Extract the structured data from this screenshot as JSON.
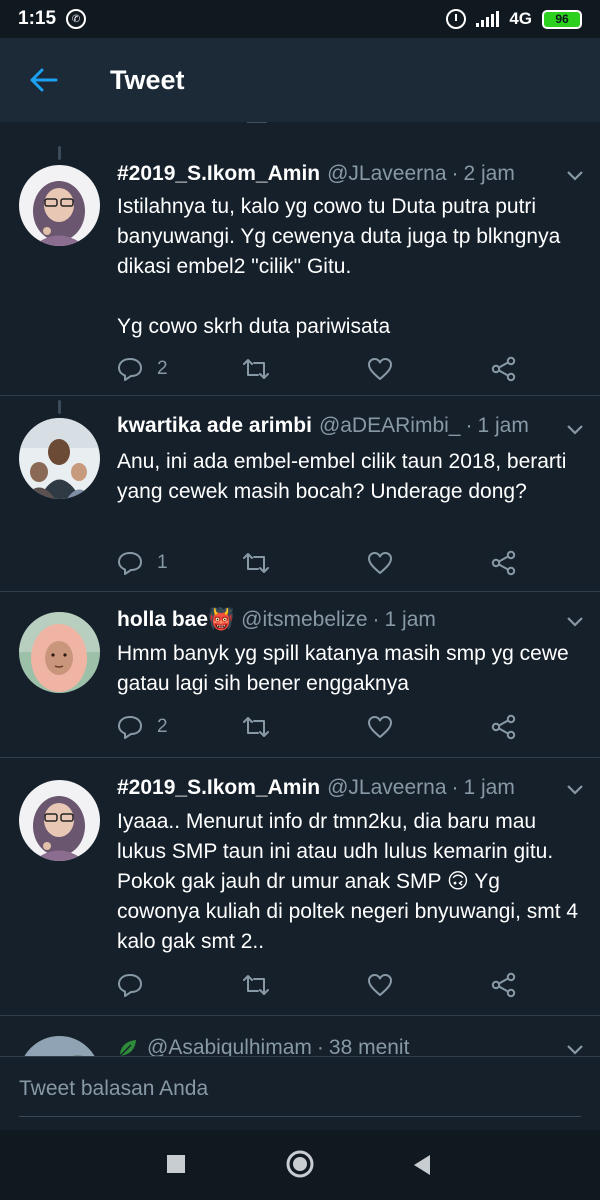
{
  "status_bar": {
    "time": "1:15",
    "network": "4G",
    "battery": "96"
  },
  "header": {
    "title": "Tweet"
  },
  "tweets": [
    {
      "name": "#2019_S.Ikom_Amin",
      "handle": "@JLaveerna",
      "time": "2 jam",
      "lines": [
        "Istilahnya tu, kalo yg cowo tu Duta putra putri banyuwangi. Yg cewenya duta juga tp blkngnya dikasi embel2 \"cilik\" Gitu.",
        "",
        "Yg cowo skrh duta pariwisata"
      ],
      "replies": "2"
    },
    {
      "name": "kwartika ade arimbi",
      "handle": "@aDEARimbi_",
      "time": "1 jam",
      "lines": [
        "Anu, ini ada embel-embel cilik taun 2018, berarti yang cewek masih bocah? Underage dong?"
      ],
      "replies": "1"
    },
    {
      "name": "holla bae👹",
      "handle": "@itsmebelize",
      "time": "1 jam",
      "lines": [
        "Hmm banyk yg spill katanya masih smp yg cewe gatau lagi sih bener enggaknya"
      ],
      "replies": "2"
    },
    {
      "name": "#2019_S.Ikom_Amin",
      "handle": "@JLaveerna",
      "time": "1 jam",
      "lines": [
        "Iyaaa.. Menurut info dr tmn2ku, dia baru mau lukus SMP taun ini atau udh lulus kemarin gitu. Pokok gak jauh dr umur anak SMP 🙃 Yg cowonya kuliah di poltek negeri bnyuwangi, smt 4 kalo gak smt 2.."
      ],
      "replies": ""
    },
    {
      "name": "",
      "handle": "@Asabiqulhimam",
      "time": "38 menit",
      "lines": [],
      "replies": ""
    }
  ],
  "reply_bar": {
    "placeholder": "Tweet balasan Anda"
  },
  "colors": {
    "background": "#15202b",
    "header": "#1c2a38",
    "accent": "#1da1f2",
    "secondary_text": "#8899a6"
  }
}
